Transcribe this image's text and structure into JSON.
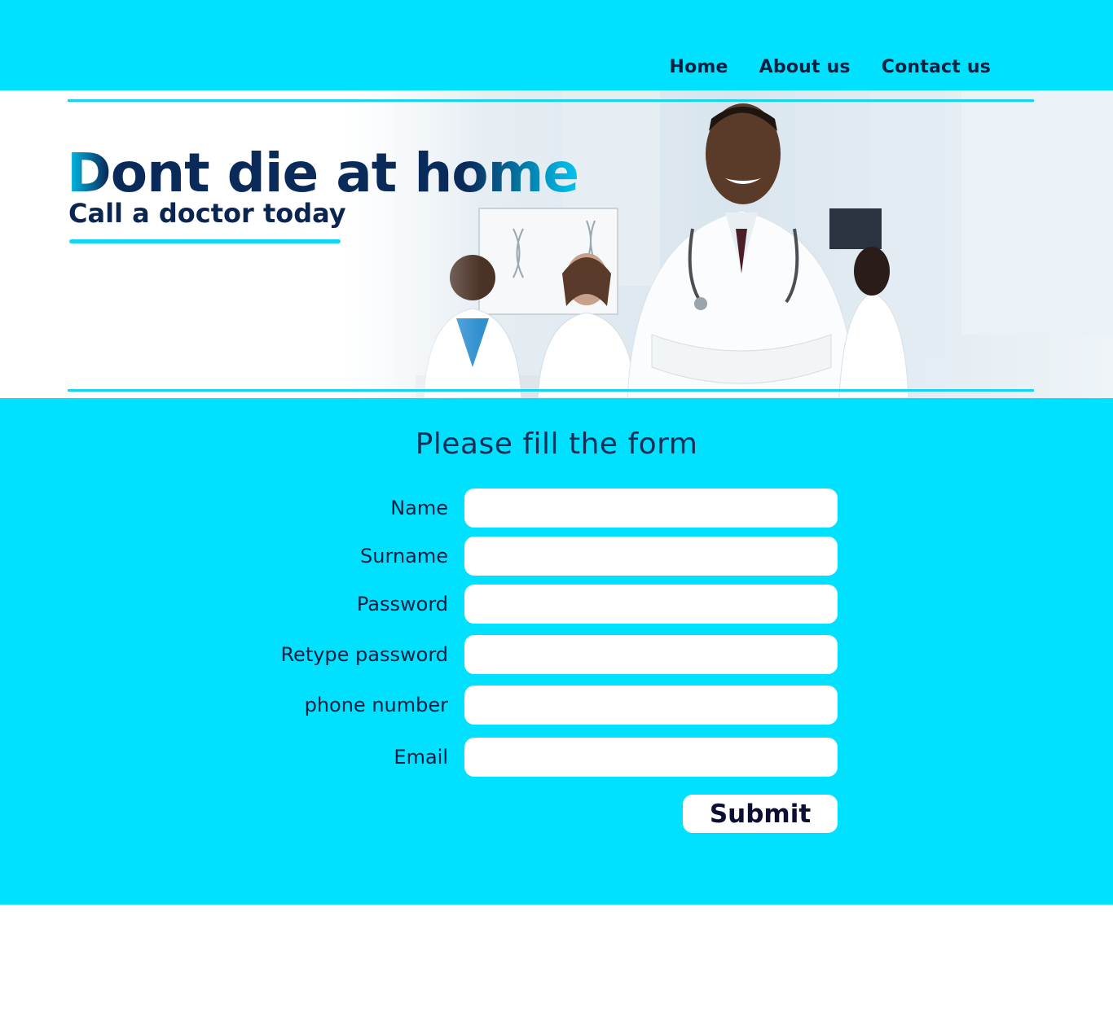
{
  "nav": {
    "items": [
      {
        "label": "Home"
      },
      {
        "label": "About us"
      },
      {
        "label": "Contact us"
      }
    ]
  },
  "hero": {
    "headline": "Dont die at home",
    "subheadline": "Call a doctor today"
  },
  "form": {
    "title": "Please fill the form",
    "fields": [
      {
        "label": "Name",
        "value": ""
      },
      {
        "label": "Surname",
        "value": ""
      },
      {
        "label": "Password",
        "value": ""
      },
      {
        "label": "Retype password",
        "value": ""
      },
      {
        "label": "phone number",
        "value": ""
      },
      {
        "label": "Email",
        "value": ""
      }
    ],
    "submit_label": "Submit"
  },
  "colors": {
    "accent": "#00e0ff",
    "line": "#14d4f4",
    "navy": "#0a2550"
  }
}
